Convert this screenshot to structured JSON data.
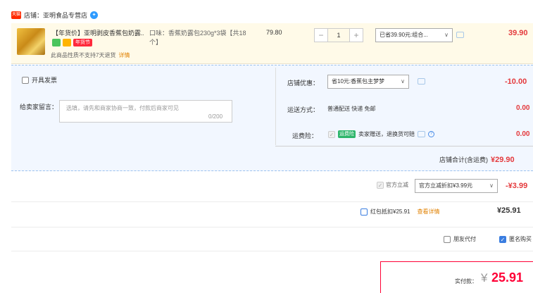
{
  "shop": {
    "badge": "天猫",
    "name": "店铺：亚明食品专营店",
    "ww_icon": "chat-icon",
    "ww_glyph": "✦"
  },
  "item": {
    "title": "【年货价】亚明剥皮香蕉包奶露...",
    "tag": "年货节",
    "return_note": "此商品性质不支持7天退货",
    "return_link": "详情",
    "attr_label": "口味：香蕉奶露包230g*3袋【共18个】",
    "unit_price": "79.80",
    "qty_minus": "−",
    "qty": "1",
    "qty_plus": "+",
    "promo_select": "已省39.90元:组合...",
    "subtotal": "39.90"
  },
  "options": {
    "invoice_label": "开具发票",
    "message_label": "给卖家留言：",
    "message_placeholder": "选填，请先和商家协商一致，付款后商家可见",
    "message_count": "0/200",
    "shop_promo_label": "店铺优惠：",
    "shop_promo_select": "省10元:香蕉包主梦梦",
    "shop_promo_amount": "-10.00",
    "shipping_label": "运送方式：",
    "shipping_value": "普通配送 快递 免邮",
    "shipping_amount": "0.00",
    "insurance_label": "运费险：",
    "insurance_badge": "运费险",
    "insurance_value": "卖家赠送，退换货可赔",
    "insurance_amount": "0.00",
    "shop_total_label": "店铺合计(含运费)",
    "shop_total_amount": "¥29.90"
  },
  "checkmark": "✓",
  "arrow": "∨",
  "help_glyph": "?",
  "discounts": {
    "official_label": "官方立减",
    "official_select": "官方立减折扣¥3.99元",
    "official_amount": "-¥3.99",
    "redpacket_label": "红包抵扣¥25.91",
    "redpacket_link": "查看详情",
    "redpacket_amount": "¥25.91"
  },
  "extras": {
    "friend_pay": "朋友代付",
    "anonymous": "匿名购买"
  },
  "payment": {
    "label": "实付款：",
    "currency": "¥",
    "amount": "25.91"
  },
  "colors": {
    "accent_red": "#e4393c",
    "pay_red": "#ff0036",
    "link_orange": "#e08000",
    "item_bg": "#fffae8",
    "options_bg": "#f2f7ff"
  }
}
